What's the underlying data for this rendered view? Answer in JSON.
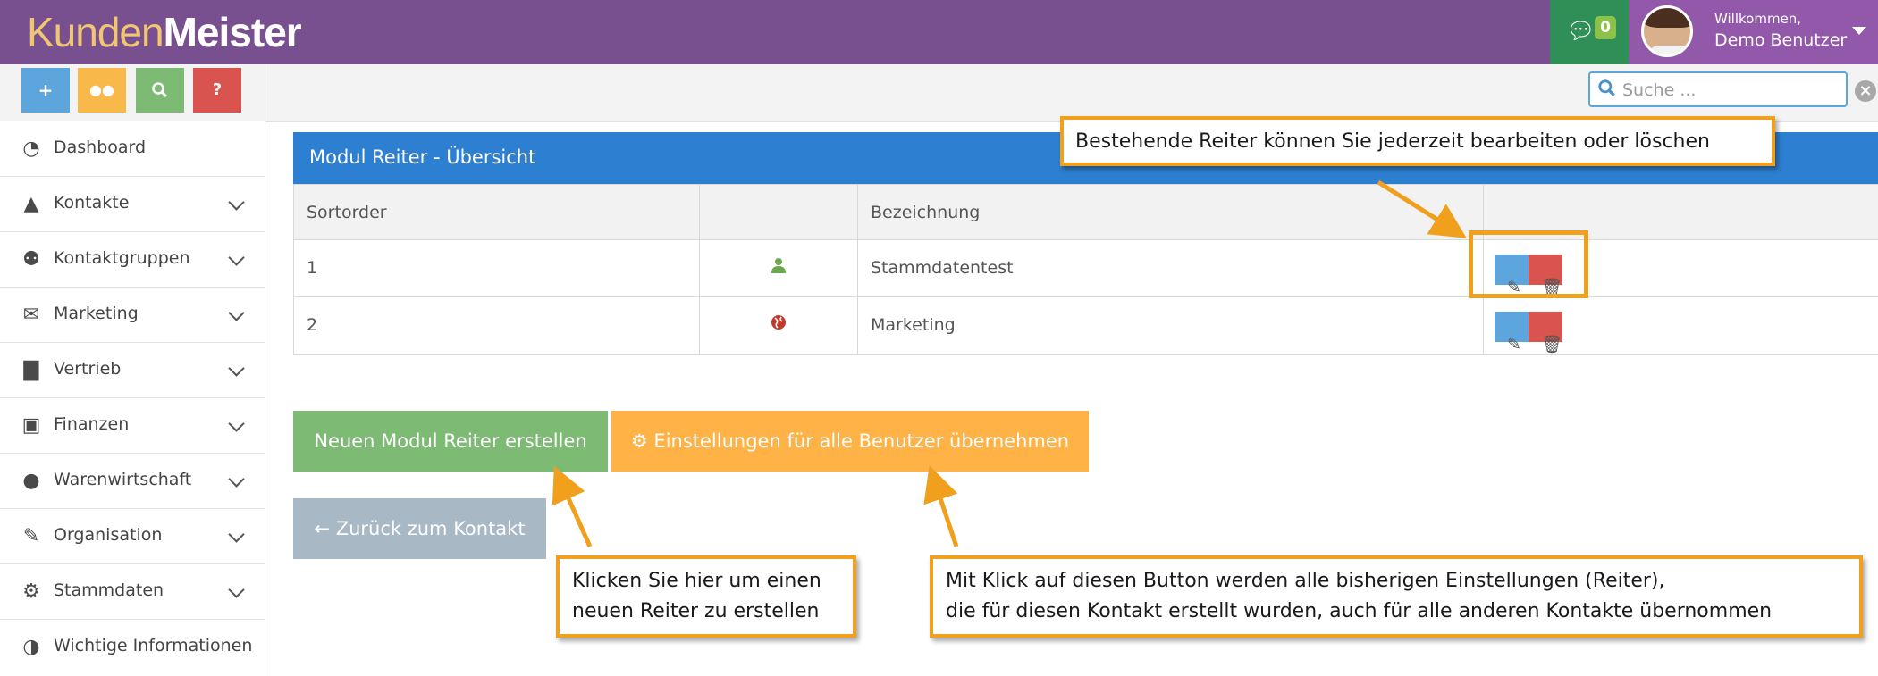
{
  "header": {
    "logo_part1": "Kunden",
    "logo_part2": "Meister",
    "message_count": "0",
    "welcome": "Willkommen,",
    "user_name": "Demo Benutzer",
    "icons": {
      "messages": "comment-icon",
      "dropdown": "caret-down-icon"
    }
  },
  "quick_buttons": [
    {
      "icon": "plus-icon",
      "glyph": "+",
      "color": "#5ca6dd"
    },
    {
      "icon": "comments-icon",
      "glyph": "💬",
      "color": "#f9b84a"
    },
    {
      "icon": "search-icon",
      "glyph": "⚲",
      "color": "#7dba74"
    },
    {
      "icon": "question-icon",
      "glyph": "?",
      "color": "#d9534f"
    }
  ],
  "search": {
    "placeholder": "Suche ..."
  },
  "sidebar": {
    "items": [
      {
        "label": "Dashboard",
        "icon": "dashboard-icon",
        "glyph": "◔"
      },
      {
        "label": "Kontakte",
        "icon": "user-icon",
        "glyph": "👤"
      },
      {
        "label": "Kontaktgruppen",
        "icon": "users-icon",
        "glyph": "👥"
      },
      {
        "label": "Marketing",
        "icon": "envelope-icon",
        "glyph": "✉"
      },
      {
        "label": "Vertrieb",
        "icon": "bar-chart-icon",
        "glyph": "▥"
      },
      {
        "label": "Finanzen",
        "icon": "money-icon",
        "glyph": "▣"
      },
      {
        "label": "Warenwirtschaft",
        "icon": "globe-icon",
        "glyph": "●"
      },
      {
        "label": "Organisation",
        "icon": "edit-icon",
        "glyph": "✎"
      },
      {
        "label": "Stammdaten",
        "icon": "cogs-icon",
        "glyph": "⚙"
      },
      {
        "label": "Wichtige Informationen",
        "icon": "adjust-icon",
        "glyph": "◑"
      }
    ]
  },
  "panel": {
    "title": "Modul Reiter - Übersicht",
    "columns": [
      "Sortorder",
      "",
      "Bezeichnung",
      ""
    ],
    "rows": [
      {
        "sortorder": "1",
        "icon": "user-icon",
        "icon_color": "#6aa84f",
        "name": "Stammdatentest"
      },
      {
        "sortorder": "2",
        "icon": "globe-icon",
        "icon_color": "#c0392b",
        "name": "Marketing"
      }
    ],
    "actions": {
      "edit_icon": "edit-icon",
      "delete_icon": "trash-icon",
      "edit_color": "#5ca6dd",
      "delete_color": "#d9534f"
    }
  },
  "buttons": {
    "new_tab": "Neuen Modul Reiter erstellen",
    "apply_all": "Einstellungen für alle Benutzer übernehmen",
    "back": "Zurück zum Kontakt"
  },
  "callouts": {
    "edit_delete": "Bestehende Reiter können Sie jederzeit bearbeiten oder löschen",
    "new_tab_line1": "Klicken Sie hier um einen",
    "new_tab_line2": "neuen Reiter zu erstellen",
    "apply_line1": "Mit Klick auf diesen Button werden alle bisherigen Einstellungen (Reiter),",
    "apply_line2": "die für diesen Kontakt erstellt wurden, auch für alle anderen Kontakte übernommen"
  },
  "colors": {
    "header": "#79508f",
    "accent_blue": "#2d7fd1",
    "green": "#7dba74",
    "orange": "#ffb246",
    "gray": "#a8b8c4",
    "callout_border": "#f0a01c"
  }
}
